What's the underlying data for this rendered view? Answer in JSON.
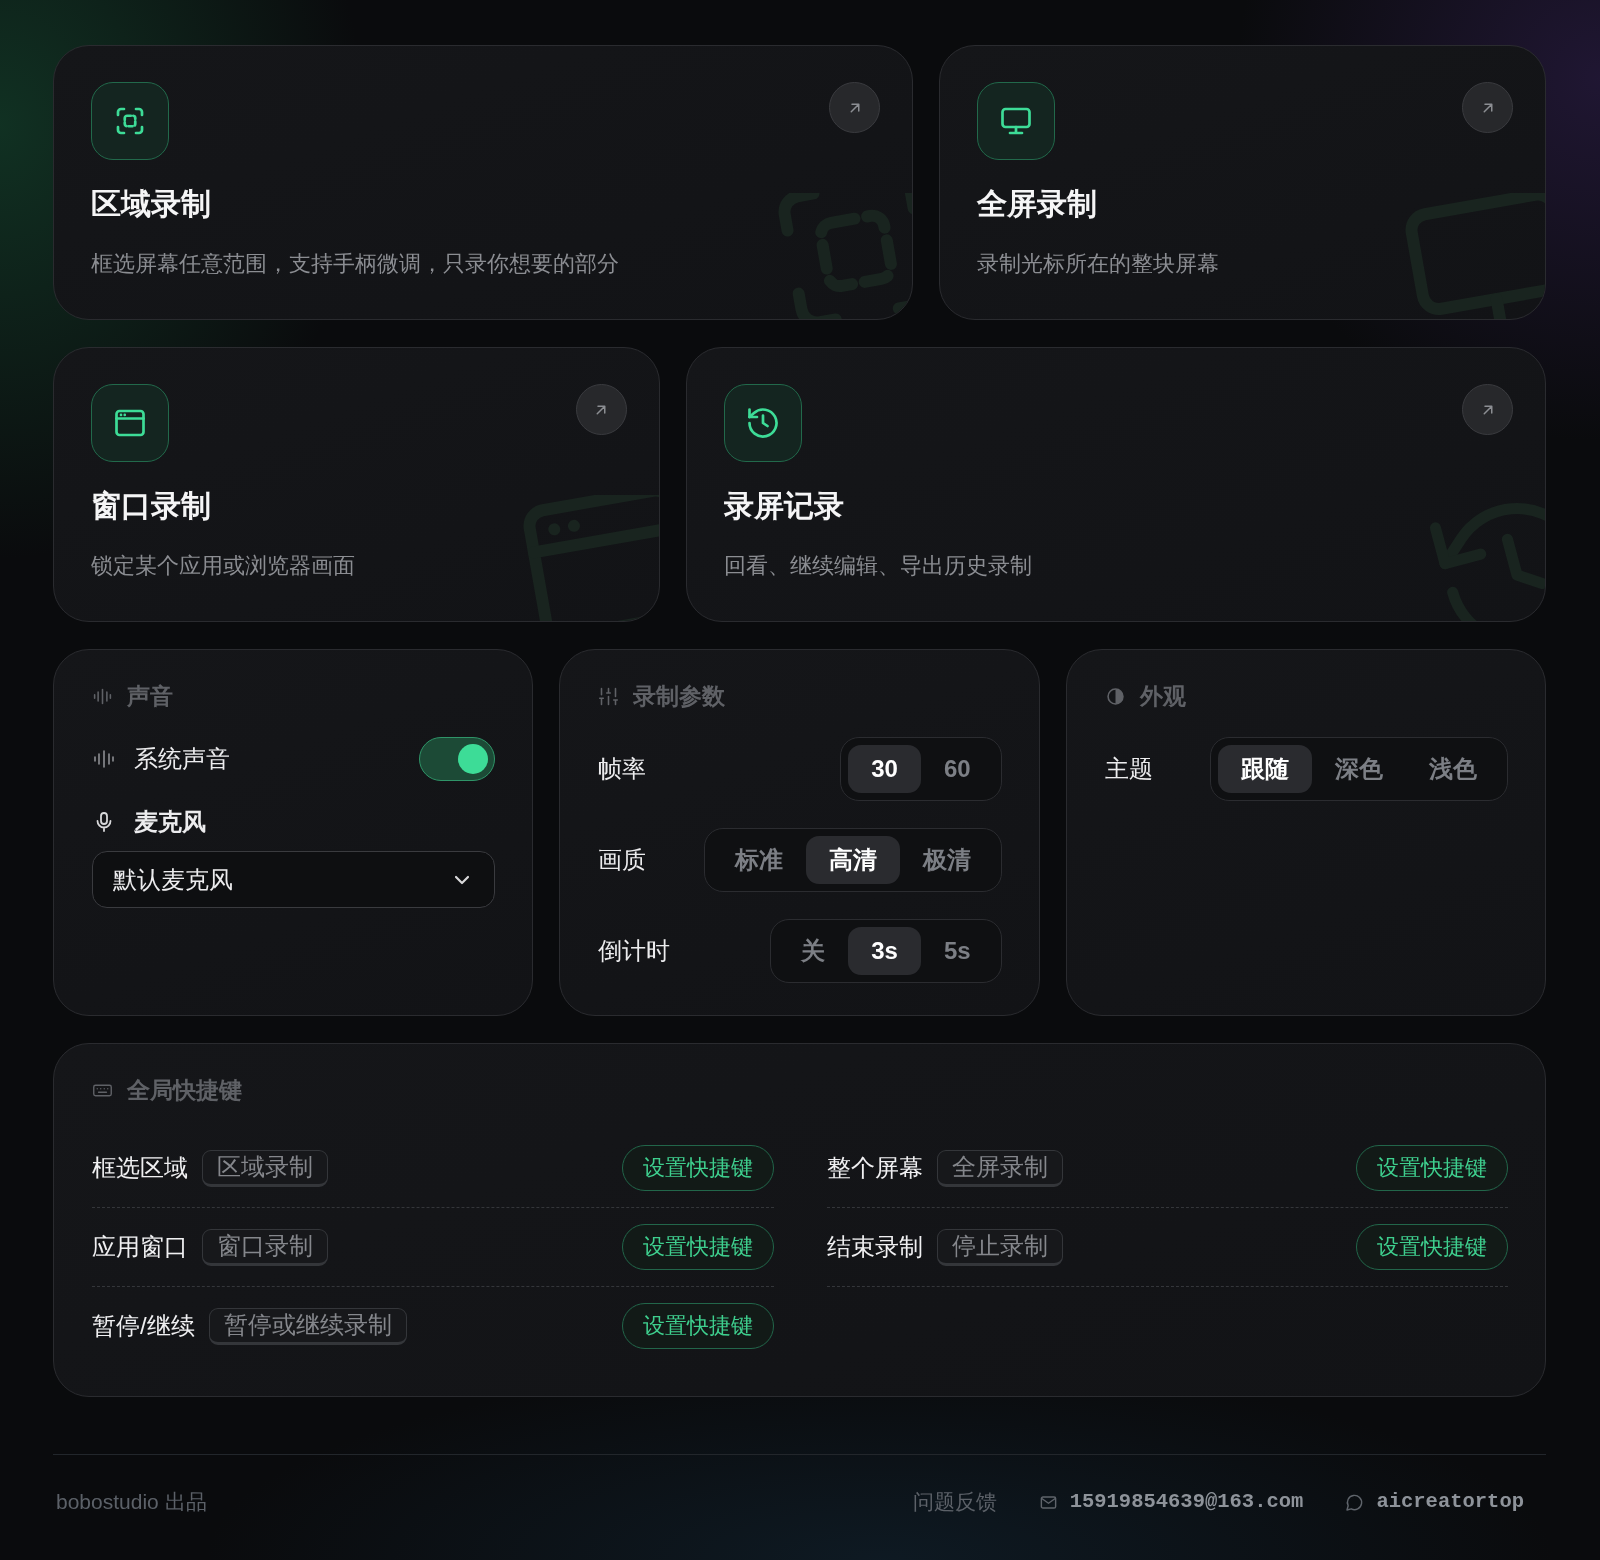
{
  "mode_cards": [
    {
      "kind": "region",
      "title": "区域录制",
      "description": "框选屏幕任意范围，支持手柄微调，只录你想要的部分"
    },
    {
      "kind": "fullscreen",
      "title": "全屏录制",
      "description": "录制光标所在的整块屏幕"
    },
    {
      "kind": "window",
      "title": "窗口录制",
      "description": "锁定某个应用或浏览器画面"
    },
    {
      "kind": "history",
      "title": "录屏记录",
      "description": "回看、继续编辑、导出历史录制"
    }
  ],
  "audio_panel": {
    "title": "声音",
    "system_sound": {
      "label": "系统声音",
      "on": true
    },
    "microphone": {
      "label": "麦克风",
      "value": "默认麦克风"
    }
  },
  "recording_panel": {
    "title": "录制参数",
    "rows": [
      {
        "label": "帧率",
        "options": [
          {
            "label": "30",
            "selected": true
          },
          {
            "label": "60",
            "selected": false
          }
        ]
      },
      {
        "label": "画质",
        "options": [
          {
            "label": "标准",
            "selected": false
          },
          {
            "label": "高清",
            "selected": true
          },
          {
            "label": "极清",
            "selected": false
          }
        ]
      },
      {
        "label": "倒计时",
        "options": [
          {
            "label": "关",
            "selected": false
          },
          {
            "label": "3s",
            "selected": true
          },
          {
            "label": "5s",
            "selected": false
          }
        ]
      }
    ]
  },
  "appearance_panel": {
    "title": "外观",
    "rows": [
      {
        "label": "主题",
        "options": [
          {
            "label": "跟随",
            "selected": true
          },
          {
            "label": "深色",
            "selected": false
          },
          {
            "label": "浅色",
            "selected": false
          }
        ]
      }
    ]
  },
  "shortcuts_panel": {
    "title": "全局快捷键",
    "items": [
      {
        "label": "框选区域",
        "action": "区域录制",
        "button": "设置快捷键"
      },
      {
        "label": "整个屏幕",
        "action": "全屏录制",
        "button": "设置快捷键"
      },
      {
        "label": "应用窗口",
        "action": "窗口录制",
        "button": "设置快捷键"
      },
      {
        "label": "结束录制",
        "action": "停止录制",
        "button": "设置快捷键"
      },
      {
        "label": "暂停/继续",
        "action": "暂停或继续录制",
        "button": "设置快捷键"
      }
    ]
  },
  "footer": {
    "credit": "bobostudio 出品",
    "links": [
      {
        "kind": "feedback",
        "label": "问题反馈"
      },
      {
        "kind": "email",
        "label": "15919854639@163.com"
      },
      {
        "kind": "wechat",
        "label": "aicreatortop"
      }
    ]
  }
}
